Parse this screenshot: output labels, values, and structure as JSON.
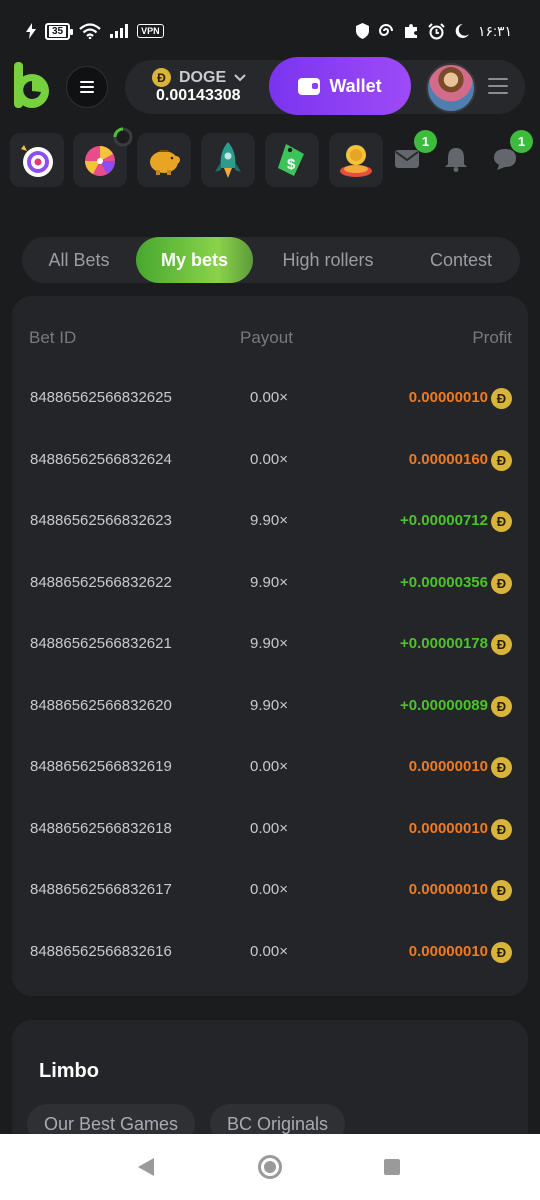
{
  "status_bar": {
    "battery": "35",
    "vpn": "VPN",
    "time": "۱۶:۳۱"
  },
  "header": {
    "currency": "DOGE",
    "balance": "0.00143308",
    "coin_symbol": "Ð",
    "wallet_label": "Wallet"
  },
  "quickbar": {
    "mail_badge": "1",
    "chat_badge": "1",
    "tiles": [
      "dart-target-icon",
      "prize-wheel-icon",
      "piggy-bank-icon",
      "rocket-icon",
      "dollar-tag-icon",
      "coin-stack-icon"
    ]
  },
  "tabs": [
    {
      "label": "All Bets",
      "active": false
    },
    {
      "label": "My bets",
      "active": true
    },
    {
      "label": "High rollers",
      "active": false
    },
    {
      "label": "Contest",
      "active": false
    }
  ],
  "bets_table": {
    "headers": {
      "id": "Bet ID",
      "payout": "Payout",
      "profit": "Profit"
    },
    "rows": [
      {
        "id": "84886562566832625",
        "payout": "0.00×",
        "profit": "0.00000010",
        "result": "loss"
      },
      {
        "id": "84886562566832624",
        "payout": "0.00×",
        "profit": "0.00000160",
        "result": "loss"
      },
      {
        "id": "84886562566832623",
        "payout": "9.90×",
        "profit": "+0.00000712",
        "result": "win"
      },
      {
        "id": "84886562566832622",
        "payout": "9.90×",
        "profit": "+0.00000356",
        "result": "win"
      },
      {
        "id": "84886562566832621",
        "payout": "9.90×",
        "profit": "+0.00000178",
        "result": "win"
      },
      {
        "id": "84886562566832620",
        "payout": "9.90×",
        "profit": "+0.00000089",
        "result": "win"
      },
      {
        "id": "84886562566832619",
        "payout": "0.00×",
        "profit": "0.00000010",
        "result": "loss"
      },
      {
        "id": "84886562566832618",
        "payout": "0.00×",
        "profit": "0.00000010",
        "result": "loss"
      },
      {
        "id": "84886562566832617",
        "payout": "0.00×",
        "profit": "0.00000010",
        "result": "loss"
      },
      {
        "id": "84886562566832616",
        "payout": "0.00×",
        "profit": "0.00000010",
        "result": "loss"
      }
    ]
  },
  "limbo": {
    "title": "Limbo",
    "chips": [
      "Our Best Games",
      "BC Originals"
    ]
  },
  "colors": {
    "accent_green": "#4cc32a",
    "loss_orange": "#f07a22",
    "wallet_purple": "#8b3ff3",
    "doge_gold": "#d8b43a"
  }
}
